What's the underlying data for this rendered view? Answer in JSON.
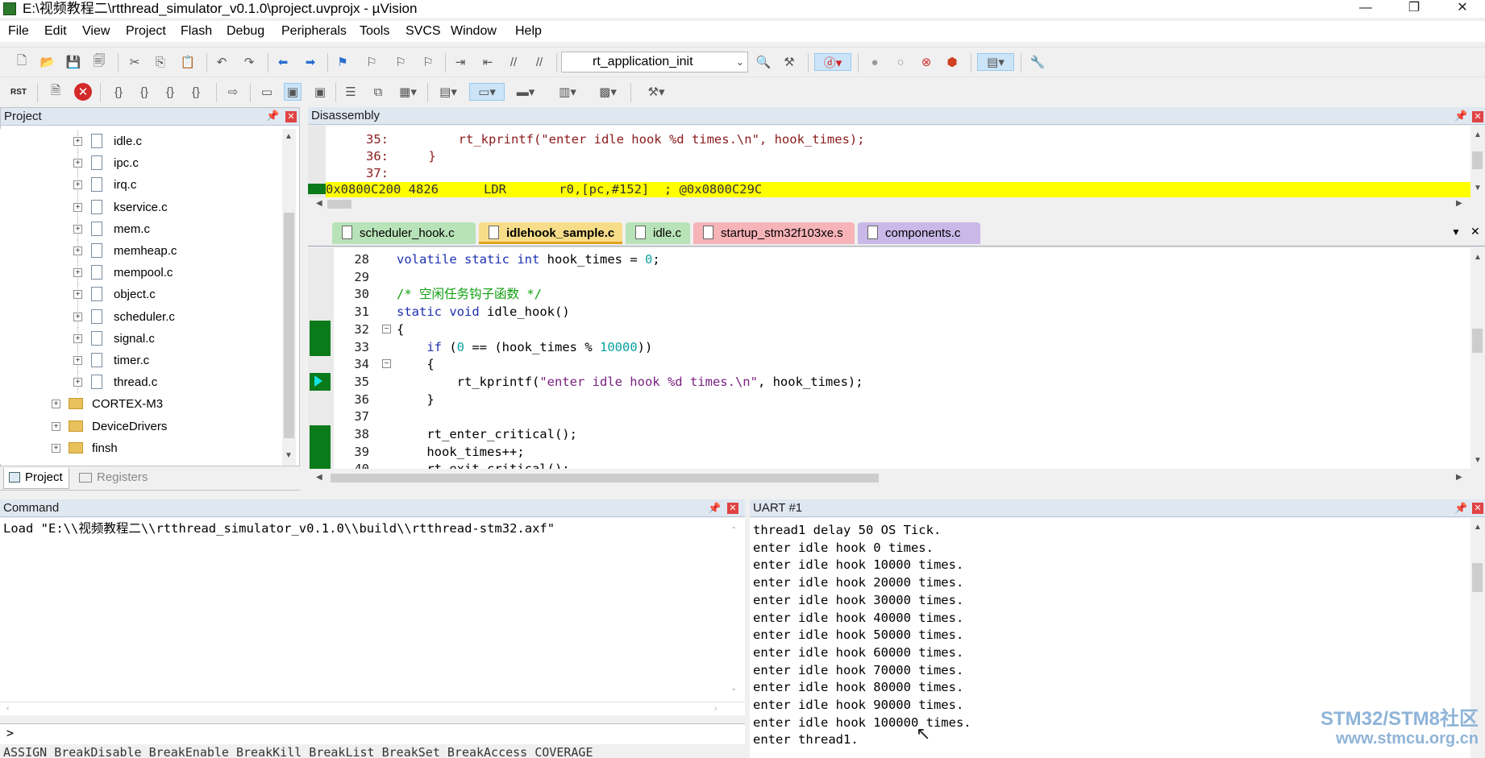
{
  "window": {
    "title": "E:\\视频教程二\\rtthread_simulator_v0.1.0\\project.uvprojx - µVision",
    "minimize": "—",
    "restore": "❐",
    "close": "✕"
  },
  "menu": [
    "File",
    "Edit",
    "View",
    "Project",
    "Flash",
    "Debug",
    "Peripherals",
    "Tools",
    "SVCS",
    "Window",
    "Help"
  ],
  "toolbar": {
    "function_combo": "rt_application_init",
    "rst_label": "RST"
  },
  "project_panel": {
    "title": "Project",
    "files": [
      "idle.c",
      "ipc.c",
      "irq.c",
      "kservice.c",
      "mem.c",
      "memheap.c",
      "mempool.c",
      "object.c",
      "scheduler.c",
      "signal.c",
      "timer.c",
      "thread.c"
    ],
    "folders": [
      "CORTEX-M3",
      "DeviceDrivers",
      "finsh"
    ],
    "tabs": [
      "Project",
      "Registers"
    ]
  },
  "disassembly": {
    "title": "Disassembly",
    "lines": [
      {
        "num": "35:",
        "text": "        rt_kprintf(\"enter idle hook %d times.\\n\", hook_times);"
      },
      {
        "num": "36:",
        "text": "    }"
      },
      {
        "num": "37:",
        "text": ""
      }
    ],
    "current": "0x0800C200 4826      LDR       r0,[pc,#152]  ; @0x0800C29C"
  },
  "editor": {
    "tabs": [
      {
        "label": "scheduler_hook.c",
        "color": "#b8e3b8"
      },
      {
        "label": "idlehook_sample.c",
        "color": "#f7dd8a",
        "active": true
      },
      {
        "label": "idle.c",
        "color": "#b8e3b8"
      },
      {
        "label": "startup_stm32f103xe.s",
        "color": "#f6b3b8"
      },
      {
        "label": "components.c",
        "color": "#c9b8e8"
      }
    ],
    "lines": [
      {
        "num": "28",
        "text": "volatile static int hook_times = 0;"
      },
      {
        "num": "29",
        "text": ""
      },
      {
        "num": "30",
        "text": "/* 空闲任务钩子函数 */"
      },
      {
        "num": "31",
        "text": "static void idle_hook()"
      },
      {
        "num": "32",
        "text": "{"
      },
      {
        "num": "33",
        "text": "    if (0 == (hook_times % 10000))"
      },
      {
        "num": "34",
        "text": "    {"
      },
      {
        "num": "35",
        "text": "        rt_kprintf(\"enter idle hook %d times.\\n\", hook_times);"
      },
      {
        "num": "36",
        "text": "    }"
      },
      {
        "num": "37",
        "text": ""
      },
      {
        "num": "38",
        "text": "    rt_enter_critical();"
      },
      {
        "num": "39",
        "text": "    hook_times++;"
      },
      {
        "num": "40",
        "text": "    rt_exit_critical();"
      }
    ]
  },
  "command_panel": {
    "title": "Command",
    "output": "Load \"E:\\\\视频教程二\\\\rtthread_simulator_v0.1.0\\\\build\\\\rtthread-stm32.axf\"",
    "prompt": ">",
    "hint": "ASSIGN BreakDisable BreakEnable BreakKill BreakList BreakSet BreakAccess COVERAGE"
  },
  "uart_panel": {
    "title": "UART #1",
    "lines": [
      "thread1 delay 50 OS Tick.",
      "enter idle hook 0 times.",
      "enter idle hook 10000 times.",
      "enter idle hook 20000 times.",
      "enter idle hook 30000 times.",
      "enter idle hook 40000 times.",
      "enter idle hook 50000 times.",
      "enter idle hook 60000 times.",
      "enter idle hook 70000 times.",
      "enter idle hook 80000 times.",
      "enter idle hook 90000 times.",
      "enter idle hook 100000 times.",
      "enter thread1."
    ]
  },
  "watermark": {
    "line1": "STM32/STM8社区",
    "line2": "www.stmcu.org.cn"
  },
  "colors": {
    "panel_header": "#dfe7f1",
    "exec_line": "#ffff00",
    "coverage": "#0a7a1a",
    "watermark": "#8fb4d8"
  }
}
